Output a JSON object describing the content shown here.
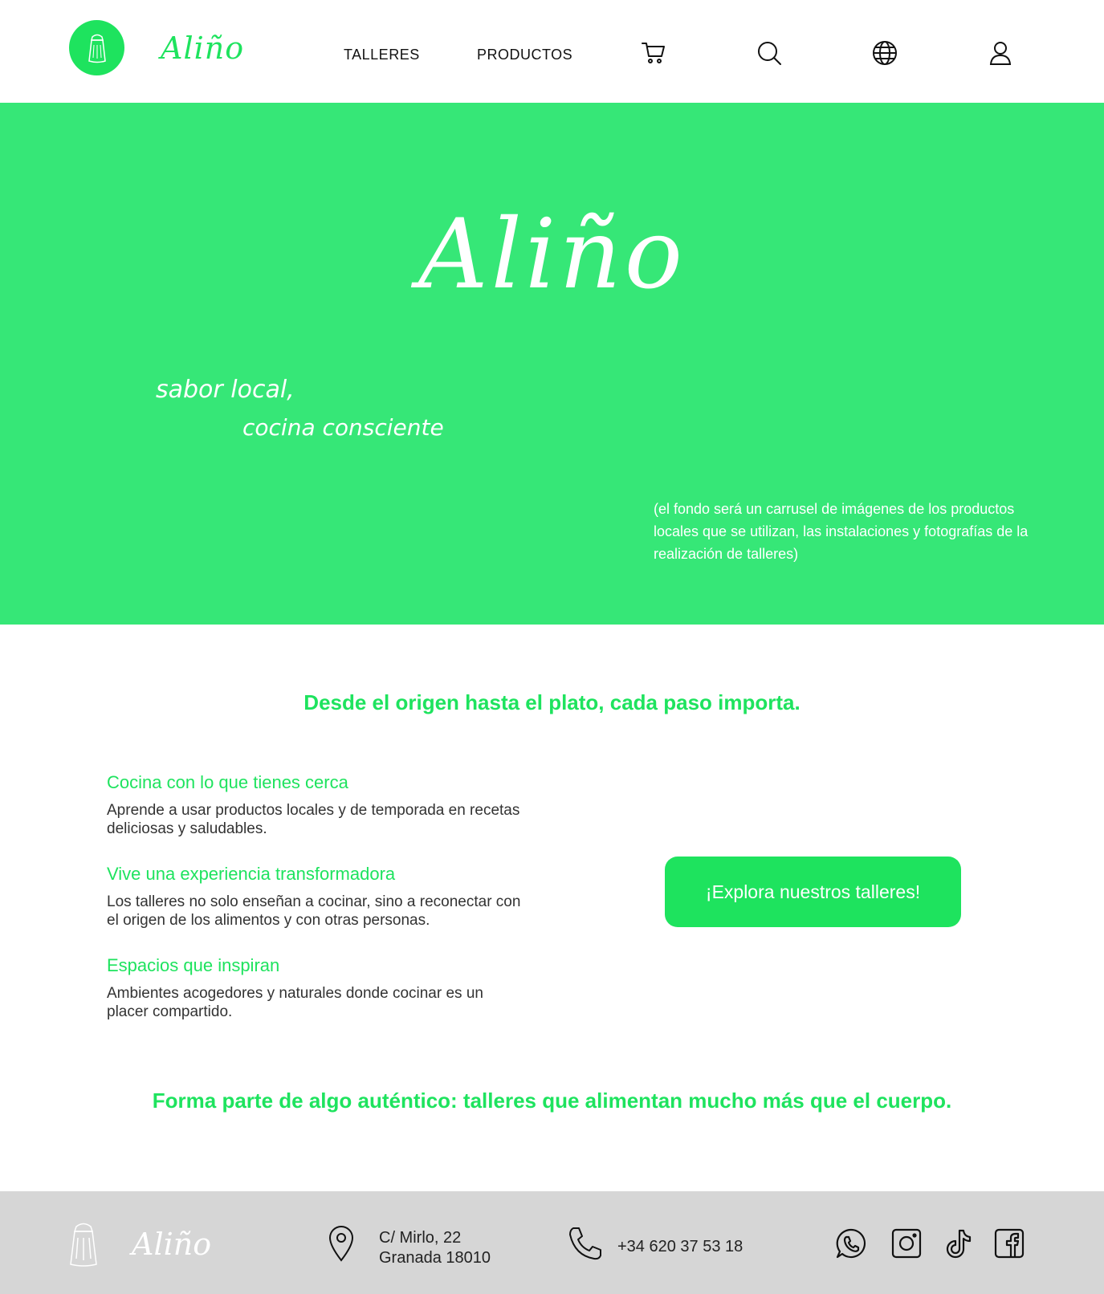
{
  "header": {
    "brand": "Aliño",
    "nav": {
      "talleres": "TALLERES",
      "productos": "PRODUCTOS"
    },
    "icons": [
      "salt-shaker-icon",
      "cart-icon",
      "search-icon",
      "globe-icon",
      "user-icon"
    ]
  },
  "hero": {
    "brand": "Aliño",
    "slogan_line1": "sabor local,",
    "slogan_line2": "cocina consciente",
    "note": "(el fondo será un carrusel de imágenes de los productos locales que se utilizan, las instalaciones y fotografías de la realización de talleres)"
  },
  "main": {
    "tagline": "Desde el origen hasta el plato, cada paso importa.",
    "features": [
      {
        "title": "Cocina con lo que tienes cerca",
        "text": "Aprende a usar productos locales y de temporada en recetas deliciosas y saludables."
      },
      {
        "title": "Vive una experiencia transformadora",
        "text": "Los talleres no solo enseñan a cocinar, sino a reconectar con el origen de los alimentos y con otras personas."
      },
      {
        "title": "Espacios que inspiran",
        "text": "Ambientes acogedores y naturales donde cocinar es un placer compartido."
      }
    ],
    "cta_label": "¡Explora nuestros talleres!",
    "closing": "Forma parte de algo auténtico: talleres que alimentan mucho más que el cuerpo."
  },
  "footer": {
    "brand": "Aliño",
    "address_line1": "C/ Mirlo, 22",
    "address_line2": "Granada 18010",
    "phone": "+34 620 37 53 18",
    "social_icons": [
      "whatsapp-icon",
      "instagram-icon",
      "tiktok-icon",
      "facebook-icon"
    ]
  },
  "colors": {
    "accent": "#1ee35e",
    "hero_bg": "#36e777",
    "footer_bg": "#d6d6d6",
    "text": "#333333"
  }
}
